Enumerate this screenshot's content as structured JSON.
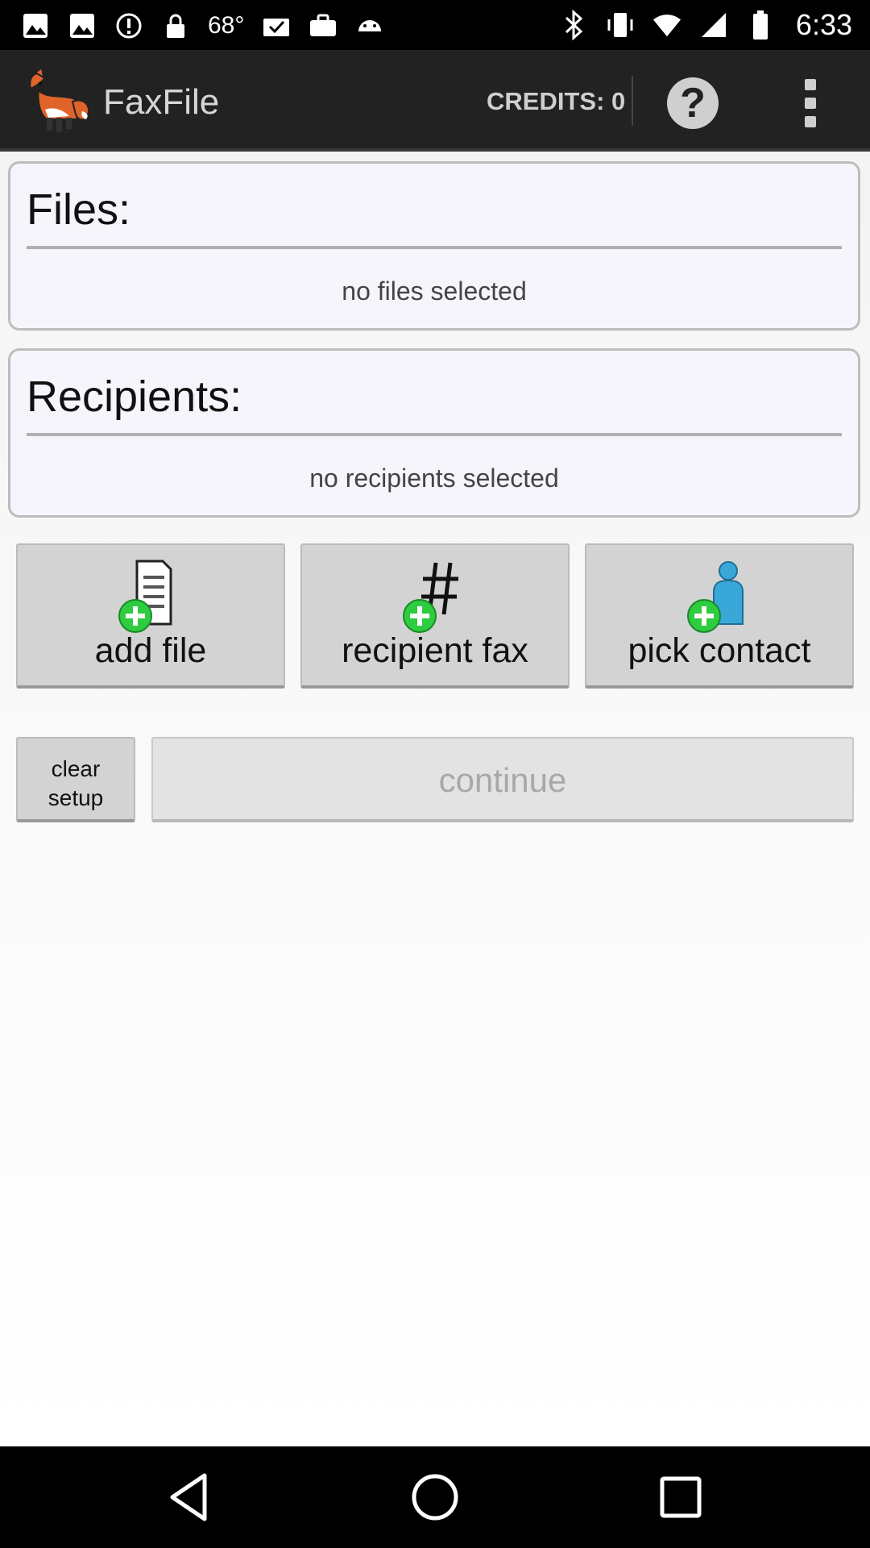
{
  "status_bar": {
    "temperature": "68°",
    "time": "6:33",
    "left_icons": [
      "image-icon",
      "image-icon",
      "alert-circle-icon",
      "lock-icon",
      "temperature-text",
      "mail-check-icon",
      "briefcase-icon",
      "android-icon"
    ],
    "right_icons": [
      "bluetooth-icon",
      "vibrate-icon",
      "wifi-icon",
      "signal-icon",
      "battery-icon"
    ]
  },
  "action_bar": {
    "title": "FaxFile",
    "credits": "CREDITS: 0",
    "help_symbol": "?"
  },
  "files_panel": {
    "title": "Files:",
    "empty_text": "no files selected"
  },
  "recipients_panel": {
    "title": "Recipients:",
    "empty_text": "no recipients selected"
  },
  "buttons": {
    "add_file": "add file",
    "recipient_fax": "recipient fax",
    "pick_contact": "pick contact",
    "clear_setup_line1": "clear",
    "clear_setup_line2": "setup",
    "continue": "continue"
  },
  "colors": {
    "action_bar_bg": "#222222",
    "plus_badge": "#2ecc40",
    "contact_icon": "#3aa7d9",
    "button_bg": "#d3d3d3",
    "panel_bg": "#f5f5fb"
  }
}
